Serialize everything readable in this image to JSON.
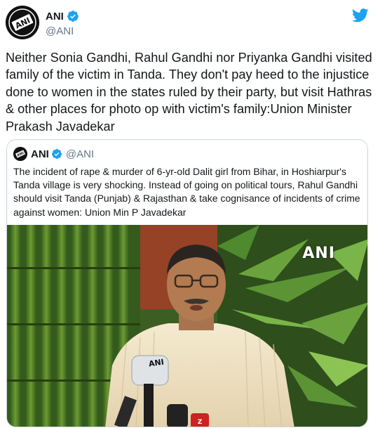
{
  "tweet": {
    "author": {
      "display_name": "ANI",
      "handle": "@ANI",
      "avatar_icon": "ani-logo-avatar",
      "verified": true
    },
    "brand_icon": "twitter-bird-icon",
    "text": "Neither Sonia Gandhi, Rahul Gandhi nor Priyanka Gandhi visited family of the victim in Tanda. They don't pay heed to the injustice done to women in the states ruled by their party, but visit Hathras & other places for photo op with victim's family:Union Minister Prakash Javadekar",
    "quoted": {
      "display_name": "ANI",
      "handle": "@ANI",
      "verified": true,
      "text": "The incident of rape & murder of 6-yr-old Dalit girl from Bihar, in Hoshiarpur's Tanda village is very shocking. Instead of going on political tours, Rahul Gandhi should visit Tanda (Punjab) & Rajasthan & take cognisance of incidents of crime against women: Union Min P Javadekar",
      "media": {
        "watermark": "ANI",
        "mic_label": "ANI"
      }
    }
  },
  "colors": {
    "twitter_blue": "#1da1f2",
    "text": "#14171a",
    "muted": "#657786",
    "border": "#ccd6dd"
  }
}
